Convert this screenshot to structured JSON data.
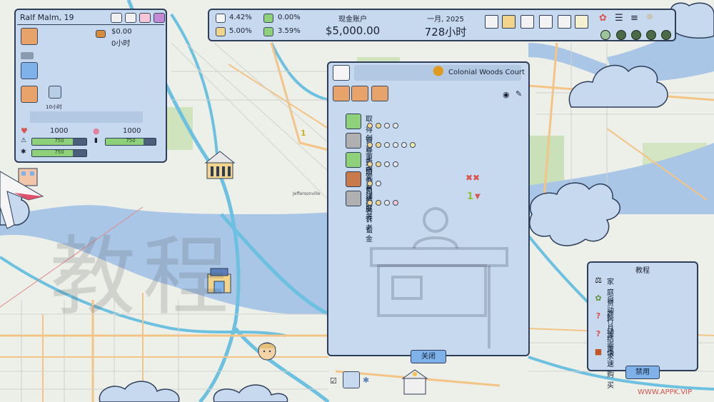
{
  "profile": {
    "name": "Ralf Malm, 19",
    "money": "$0.00",
    "hours": "0小时",
    "time_badge": "10小时",
    "stat1_value": "1000",
    "stat2_value": "1000",
    "bar1_label": "750",
    "bar2_label": "750",
    "bar3_label": "750",
    "bar1_level": 0.75,
    "bar2_level": 0.75,
    "bar3_level": 0.75
  },
  "topbar": {
    "rate1": "4.42%",
    "rate2": "0.00%",
    "rate3": "5.00%",
    "rate4": "3.59%",
    "account_label": "现金账户",
    "balance": "$5,000.00",
    "date": "一月, 2025",
    "hours": "728小时"
  },
  "dialog": {
    "title": "Colonial Woods Court",
    "actions": [
      {
        "label": "取得营业执照"
      },
      {
        "label": "创建上市公司"
      },
      {
        "label": "更改人员姓名"
      },
      {
        "label": "观看法庭诉讼"
      },
      {
        "label": "领取养老金"
      }
    ],
    "close_label": "关闭",
    "reward_number": "1"
  },
  "map": {
    "place_label": "Jeffersonville",
    "marker_number": "1"
  },
  "tutorial": {
    "title": "教程",
    "items": [
      {
        "label": "家庭资产",
        "icon": "family-assets-icon"
      },
      {
        "label": "自动行动",
        "icon": "auto-action-icon"
      },
      {
        "label": "整月结束",
        "icon": "question-icon"
      },
      {
        "label": "零需求",
        "icon": "question-icon"
      },
      {
        "label": "快速购买",
        "icon": "shopping-bag-icon"
      }
    ],
    "disable_label": "禁用"
  },
  "watermark": {
    "text": "WWW.APPK.VIP"
  },
  "colors": {
    "panel": "#c7d9ee",
    "border": "#2e3e58",
    "button": "#7fb2e8",
    "bar_fill": "#8fd07a",
    "river": "#a9c6e6"
  }
}
